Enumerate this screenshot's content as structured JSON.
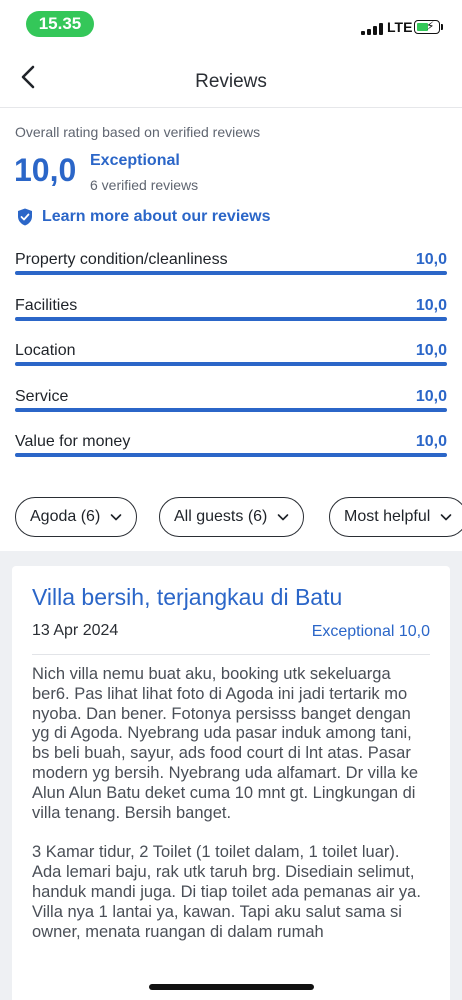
{
  "status_bar": {
    "time": "15.35",
    "network": "LTE"
  },
  "nav": {
    "title": "Reviews"
  },
  "overall": {
    "label": "Overall rating based on verified reviews",
    "score": "10,0",
    "word": "Exceptional",
    "count": "6 verified reviews"
  },
  "learn_more": "Learn more about our reviews",
  "categories": [
    {
      "label": "Property condition/cleanliness",
      "value": "10,0",
      "fill_fraction": 1.0
    },
    {
      "label": "Facilities",
      "value": "10,0",
      "fill_fraction": 1.0
    },
    {
      "label": "Location",
      "value": "10,0",
      "fill_fraction": 1.0
    },
    {
      "label": "Service",
      "value": "10,0",
      "fill_fraction": 1.0
    },
    {
      "label": "Value for money",
      "value": "10,0",
      "fill_fraction": 1.0
    }
  ],
  "filters": [
    {
      "label": "Agoda (6)"
    },
    {
      "label": "All guests (6)"
    },
    {
      "label": "Most helpful"
    }
  ],
  "review": {
    "title": "Villa bersih, terjangkau di Batu",
    "date": "13 Apr 2024",
    "rating": "Exceptional 10,0",
    "paragraphs": [
      "Nich villa nemu buat aku, booking utk sekeluarga ber6. Pas lihat lihat foto di Agoda ini jadi tertarik mo nyoba. Dan bener. Fotonya persisss banget dengan yg di Agoda. Nyebrang uda pasar induk among tani, bs beli buah, sayur, ads food court di lnt atas. Pasar modern yg bersih. Nyebrang uda alfamart. Dr villa ke Alun Alun Batu deket cuma 10 mnt gt. Lingkungan di villa tenang. Bersih banget.",
      "3 Kamar tidur, 2 Toilet (1 toilet dalam, 1 toilet luar). Ada lemari baju, rak utk taruh brg. Disediain selimut, handuk mandi juga. Di tiap toilet ada pemanas air ya. Villa nya 1 lantai ya, kawan. Tapi aku salut sama si owner, menata ruangan di dalam rumah"
    ]
  },
  "colors": {
    "accent": "#2b66c8",
    "track": "#dfe3ea",
    "time_pill": "#34c759",
    "background_gray": "#eef0f3"
  },
  "icons": {
    "back": "chevron-left-icon",
    "shield": "shield-check-icon",
    "chip_chevron": "chevron-down-icon"
  }
}
